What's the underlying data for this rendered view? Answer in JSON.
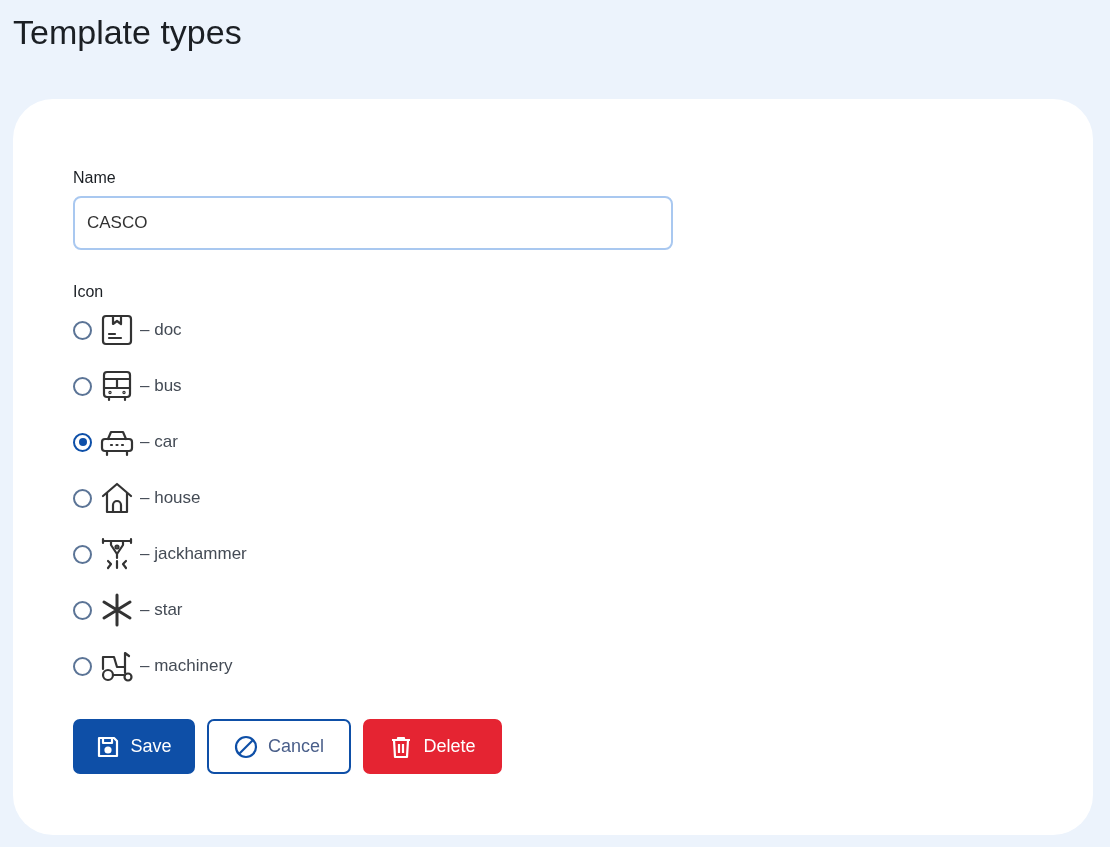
{
  "page": {
    "title": "Template types"
  },
  "form": {
    "name_label": "Name",
    "name_value": "CASCO",
    "icon_label": "Icon",
    "options": [
      {
        "kind": "doc",
        "label": "– doc",
        "selected": false
      },
      {
        "kind": "bus",
        "label": "– bus",
        "selected": false
      },
      {
        "kind": "car",
        "label": "– car",
        "selected": true
      },
      {
        "kind": "house",
        "label": "– house",
        "selected": false
      },
      {
        "kind": "jackhammer",
        "label": "– jackhammer",
        "selected": false
      },
      {
        "kind": "star",
        "label": "– star",
        "selected": false
      },
      {
        "kind": "machinery",
        "label": "– machinery",
        "selected": false
      }
    ],
    "buttons": [
      {
        "kind": "save",
        "label": "Save"
      },
      {
        "kind": "cancel",
        "label": "Cancel"
      },
      {
        "kind": "delete",
        "label": "Delete"
      }
    ]
  }
}
